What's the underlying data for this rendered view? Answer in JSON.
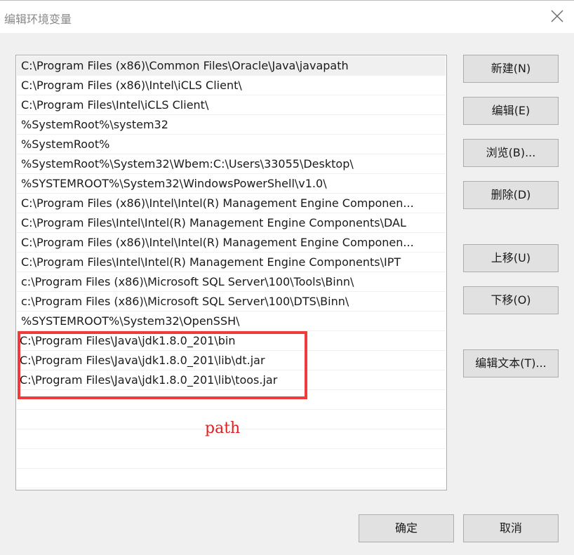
{
  "window": {
    "title": "编辑环境变量"
  },
  "list": {
    "items": [
      "C:\\Program Files (x86)\\Common Files\\Oracle\\Java\\javapath",
      "C:\\Program Files (x86)\\Intel\\iCLS Client\\",
      "C:\\Program Files\\Intel\\iCLS Client\\",
      "%SystemRoot%\\system32",
      "%SystemRoot%",
      "%SystemRoot%\\System32\\Wbem:C:\\Users\\33055\\Desktop\\",
      "%SYSTEMROOT%\\System32\\WindowsPowerShell\\v1.0\\",
      "C:\\Program Files (x86)\\Intel\\Intel(R) Management Engine Componen...",
      "C:\\Program Files\\Intel\\Intel(R) Management Engine Components\\DAL",
      "C:\\Program Files (x86)\\Intel\\Intel(R) Management Engine Componen...",
      "C:\\Program Files\\Intel\\Intel(R) Management Engine Components\\IPT",
      "c:\\Program Files (x86)\\Microsoft SQL Server\\100\\Tools\\Binn\\",
      "c:\\Program Files (x86)\\Microsoft SQL Server\\100\\DTS\\Binn\\",
      "%SYSTEMROOT%\\System32\\OpenSSH\\",
      "C:\\Program Files\\Java\\jdk1.8.0_201\\bin",
      "C:\\Program Files\\Java\\jdk1.8.0_201\\lib\\dt.jar",
      "C:\\Program Files\\Java\\jdk1.8.0_201\\lib\\toos.jar"
    ]
  },
  "annotation": {
    "text": "path",
    "color": "#e02020"
  },
  "buttons": {
    "new": "新建(N)",
    "edit": "编辑(E)",
    "browse": "浏览(B)...",
    "delete": "删除(D)",
    "move_up": "上移(U)",
    "move_down": "下移(O)",
    "edit_text": "编辑文本(T)...",
    "ok": "确定",
    "cancel": "取消"
  },
  "icons": {
    "close": "close-icon"
  },
  "colors": {
    "highlight_border": "#ee3b3b",
    "selected_row": "#f0f0f0",
    "button_face": "#e1e1e1"
  }
}
